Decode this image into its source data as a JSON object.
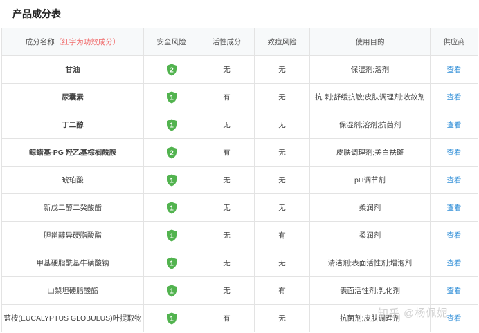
{
  "page": {
    "title": "产品成分表"
  },
  "table": {
    "headers": {
      "name": "成分名称",
      "name_hint": "（红字为功效成分）",
      "safety": "安全风险",
      "active": "活性成分",
      "acne": "致痘风险",
      "purpose": "使用目的",
      "supplier": "供应商"
    },
    "rows": [
      {
        "name": "甘油",
        "highlight": true,
        "safety": "2",
        "active": "无",
        "acne": "无",
        "purpose": "保湿剂;溶剂",
        "supplier": "查看"
      },
      {
        "name": "尿囊素",
        "highlight": true,
        "safety": "1",
        "active": "有",
        "acne": "无",
        "purpose": "抗    刺;舒缓抗敏;皮肤调理剂;收敛剂",
        "supplier": "查看"
      },
      {
        "name": "丁二醇",
        "highlight": true,
        "safety": "1",
        "active": "无",
        "acne": "无",
        "purpose": "保湿剂;溶剂;抗菌剂",
        "supplier": "查看"
      },
      {
        "name": "鲸蜡基-PG 羟乙基棕榈酰胺",
        "highlight": true,
        "safety": "2",
        "active": "有",
        "acne": "无",
        "purpose": "皮肤调理剂;美白祛斑",
        "supplier": "查看"
      },
      {
        "name": "琥珀酸",
        "highlight": false,
        "safety": "1",
        "active": "无",
        "acne": "无",
        "purpose": "pH调节剂",
        "supplier": "查看"
      },
      {
        "name": "新戊二醇二癸酸酯",
        "highlight": false,
        "safety": "1",
        "active": "无",
        "acne": "无",
        "purpose": "柔润剂",
        "supplier": "查看"
      },
      {
        "name": "胆甾醇异硬脂酸酯",
        "highlight": false,
        "safety": "1",
        "active": "无",
        "acne": "有",
        "purpose": "柔润剂",
        "supplier": "查看"
      },
      {
        "name": "甲基硬脂酰基牛磺酸钠",
        "highlight": false,
        "safety": "1",
        "active": "无",
        "acne": "无",
        "purpose": "清洁剂;表面活性剂;增泡剂",
        "supplier": "查看"
      },
      {
        "name": "山梨坦硬脂酸酯",
        "highlight": false,
        "safety": "1",
        "active": "无",
        "acne": "有",
        "purpose": "表面活性剂;乳化剂",
        "supplier": "查看"
      },
      {
        "name": "蓝桉(EUCALYPTUS GLOBULUS)叶提取物",
        "highlight": false,
        "safety": "1",
        "active": "有",
        "acne": "无",
        "purpose": "抗菌剂;皮肤调理剂",
        "supplier": "查看"
      }
    ]
  },
  "colors": {
    "shield": "#52b34f",
    "highlight_name": "#e0493f",
    "normal_name": "#3d8fd1",
    "link": "#2f8ed7"
  },
  "watermark": "知乎 @杨佩妮",
  "icons": {
    "safety": "shield-icon"
  }
}
